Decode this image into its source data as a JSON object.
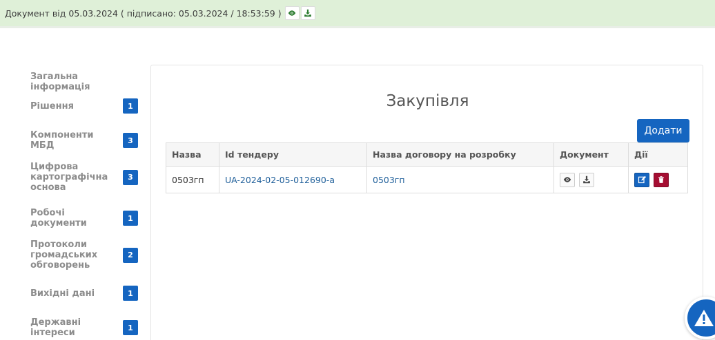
{
  "topbar": {
    "document_text": "Документ від 05.03.2024 ( підписано: 05.03.2024 / 18:53:59 )",
    "view_icon": "eye-icon",
    "download_icon": "download-icon",
    "background": "#dff0d8"
  },
  "sidebar": {
    "items": [
      {
        "label": "Загальна інформація",
        "count": ""
      },
      {
        "label": "Рішення",
        "count": "1"
      },
      {
        "label": "Компоненти МБД",
        "count": "3"
      },
      {
        "label": "Цифрова картографічна основа",
        "count": "3"
      },
      {
        "label": "Робочі документи",
        "count": "1"
      },
      {
        "label": "Протоколи громадських обговорень",
        "count": "2"
      },
      {
        "label": "Вихідні дані",
        "count": "1"
      },
      {
        "label": "Державні інтереси",
        "count": "1"
      }
    ],
    "badge_color": "#1565c0"
  },
  "main": {
    "title": "Закупівля",
    "add_label": "Додати",
    "table": {
      "headers": [
        "Назва",
        "Id тендеру",
        "Назва договору на розробку",
        "Документ",
        "Дії"
      ],
      "rows": [
        {
          "name": "0503гп",
          "tender_id": "UA-2024-02-05-012690-a",
          "contract": "0503гп"
        }
      ]
    }
  },
  "colors": {
    "accent": "#1565c0",
    "danger": "#a50e32",
    "link": "#1f5f9a"
  }
}
